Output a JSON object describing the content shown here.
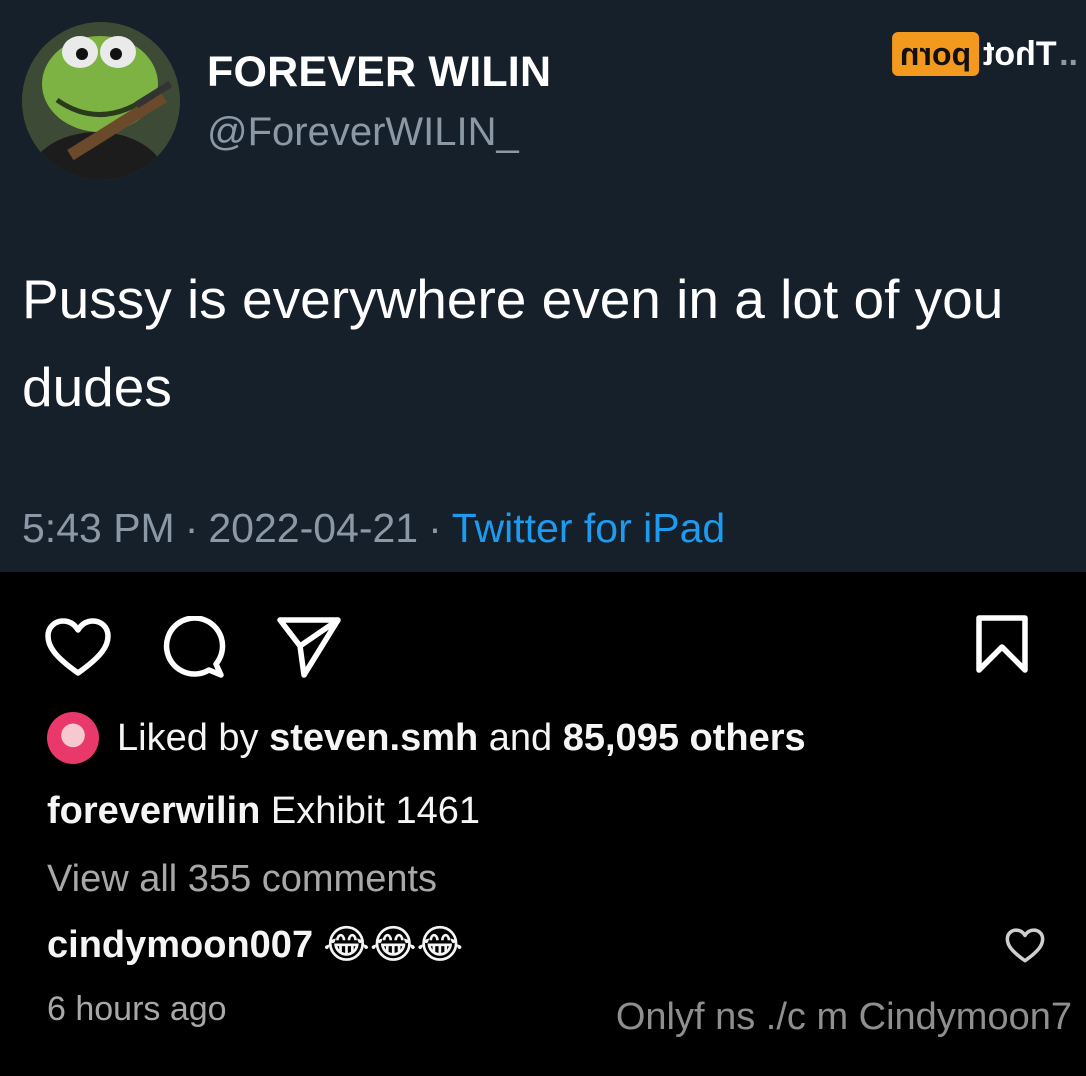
{
  "tweet": {
    "avatar_icon": "kermit-frog-avatar",
    "display_name": "FOREVER WILIN",
    "handle": "@ForeverWILIN_",
    "text": "Pussy is everywhere even in a lot of you dudes",
    "time": "5:43 PM",
    "separator": "·",
    "date": "2022-04-21",
    "source": "Twitter for iPad"
  },
  "watermark": {
    "box_text": "porn",
    "text": "Thot",
    "dots": ".."
  },
  "post": {
    "actions": [
      "heart-icon",
      "comment-icon",
      "share-icon",
      "bookmark-icon"
    ],
    "likes": {
      "prefix": "Liked by",
      "user": "steven.smh",
      "middle": "and",
      "count": "85,095 others"
    },
    "caption": {
      "user": "foreverwilin",
      "text": "Exhibit 1461"
    },
    "view_all": "View all 355 comments",
    "comment": {
      "user": "cindymoon007",
      "text": "😂😂😂"
    },
    "time_ago": "6 hours ago",
    "promo_text": "Onlyf ns ./c m Cindymoon7"
  },
  "colors": {
    "tweet_bg": "#15202b",
    "link": "#1d9bf0",
    "muted": "#8b98a5",
    "watermark_box": "#f39a1e"
  }
}
